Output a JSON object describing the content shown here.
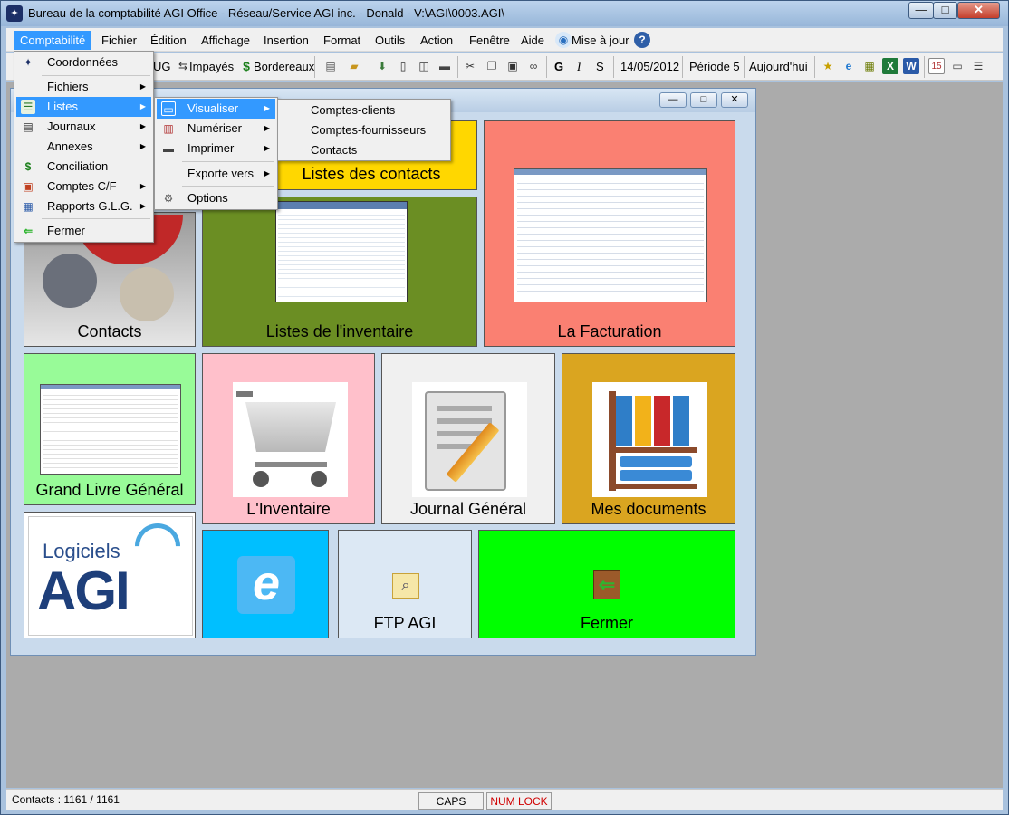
{
  "window": {
    "title": "Bureau de la comptabilité AGI Office - Réseau/Service AGI inc. - Donald - V:\\AGI\\0003.AGI\\",
    "minimize": "—",
    "maximize": "□",
    "close": "✕"
  },
  "menubar": {
    "items": [
      "Comptabilité",
      "Fichier",
      "Édition",
      "Affichage",
      "Insertion",
      "Format",
      "Outils",
      "Action",
      "Fenêtre",
      "Aide",
      "Mise à jour"
    ]
  },
  "toolbar": {
    "glg_partial": "UG",
    "impayes": "Impayés",
    "bordereaux": "Bordereaux",
    "bold": "G",
    "italic": "I",
    "underline": "S",
    "date": "14/05/2012",
    "periode": "Période 5",
    "today": "Aujourd'hui"
  },
  "menu_comptabilite": {
    "items": [
      "Coordonnées",
      "Fichiers",
      "Listes",
      "Journaux",
      "Annexes",
      "Conciliation",
      "Comptes C/F",
      "Rapports G.L.G.",
      "Fermer"
    ]
  },
  "menu_listes": {
    "items": [
      "Visualiser",
      "Numériser",
      "Imprimer",
      "Exporte vers",
      "Options"
    ]
  },
  "menu_visualiser": {
    "items": [
      "Comptes-clients",
      "Comptes-fournisseurs",
      "Contacts"
    ]
  },
  "tiles": {
    "contacts": "Contacts",
    "listes_contacts": "Listes des contacts",
    "listes_inventaire": "Listes de l'inventaire",
    "facturation": "La Facturation",
    "grand_livre": "Grand Livre Général",
    "inventaire": "L'Inventaire",
    "journal": "Journal Général",
    "documents": "Mes documents",
    "logo_top": "Logiciels",
    "logo_main": "AGI",
    "ftp": "FTP AGI",
    "fermer": "Fermer"
  },
  "statusbar": {
    "contacts": "Contacts : 1161 / 1161",
    "caps": "CAPS",
    "numlock": "NUM LOCK"
  },
  "colors": {
    "menu_highlight": "#3399ff",
    "tile_contacts_list": "#ffd700",
    "tile_inventaire_list": "#6b8e23",
    "tile_facturation": "#fa8072",
    "tile_grand_livre": "#98fb98",
    "tile_inventaire": "#ffc0cb",
    "tile_journal": "#f0f0f0",
    "tile_documents": "#daa520",
    "tile_ie": "#00bfff",
    "tile_ftp": "#dce8f4",
    "tile_fermer": "#00ff00",
    "numlock_text": "#d00000"
  }
}
